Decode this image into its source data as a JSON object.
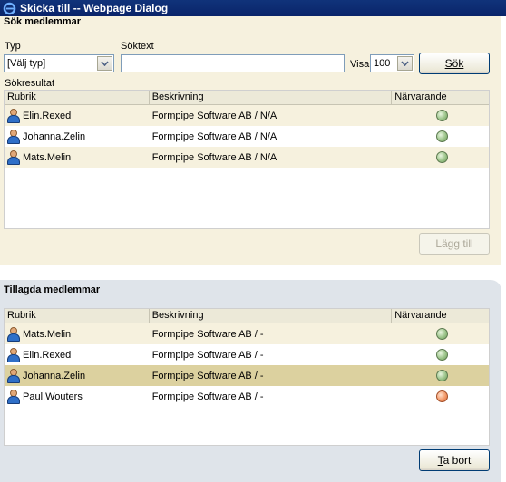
{
  "window": {
    "title": "Skicka till -- Webpage Dialog"
  },
  "search_section": {
    "title": "Sök medlemmar",
    "type_label": "Typ",
    "type_value": "[Välj typ]",
    "searchtext_label": "Söktext",
    "searchtext_value": "",
    "show_label": "Visa",
    "show_value": "100",
    "search_button": "Sök",
    "results_label": "Sökresultat",
    "columns": [
      "Rubrik",
      "Beskrivning",
      "Närvarande"
    ],
    "rows": [
      {
        "name": "Elin.Rexed",
        "description": "Formpipe Software AB / N/A",
        "presence": "green"
      },
      {
        "name": "Johanna.Zelin",
        "description": "Formpipe Software AB / N/A",
        "presence": "green"
      },
      {
        "name": "Mats.Melin",
        "description": "Formpipe Software AB / N/A",
        "presence": "green"
      }
    ],
    "add_button": "Lägg till"
  },
  "added_section": {
    "title": "Tillagda medlemmar",
    "columns": [
      "Rubrik",
      "Beskrivning",
      "Närvarande"
    ],
    "rows": [
      {
        "name": "Mats.Melin",
        "description": "Formpipe Software AB / -",
        "presence": "green"
      },
      {
        "name": "Elin.Rexed",
        "description": "Formpipe Software AB / -",
        "presence": "green"
      },
      {
        "name": "Johanna.Zelin",
        "description": "Formpipe Software AB / -",
        "presence": "green"
      },
      {
        "name": "Paul.Wouters",
        "description": "Formpipe Software AB / -",
        "presence": "orange"
      }
    ],
    "remove_button_prefix": "T",
    "remove_button_rest": "a bort"
  }
}
